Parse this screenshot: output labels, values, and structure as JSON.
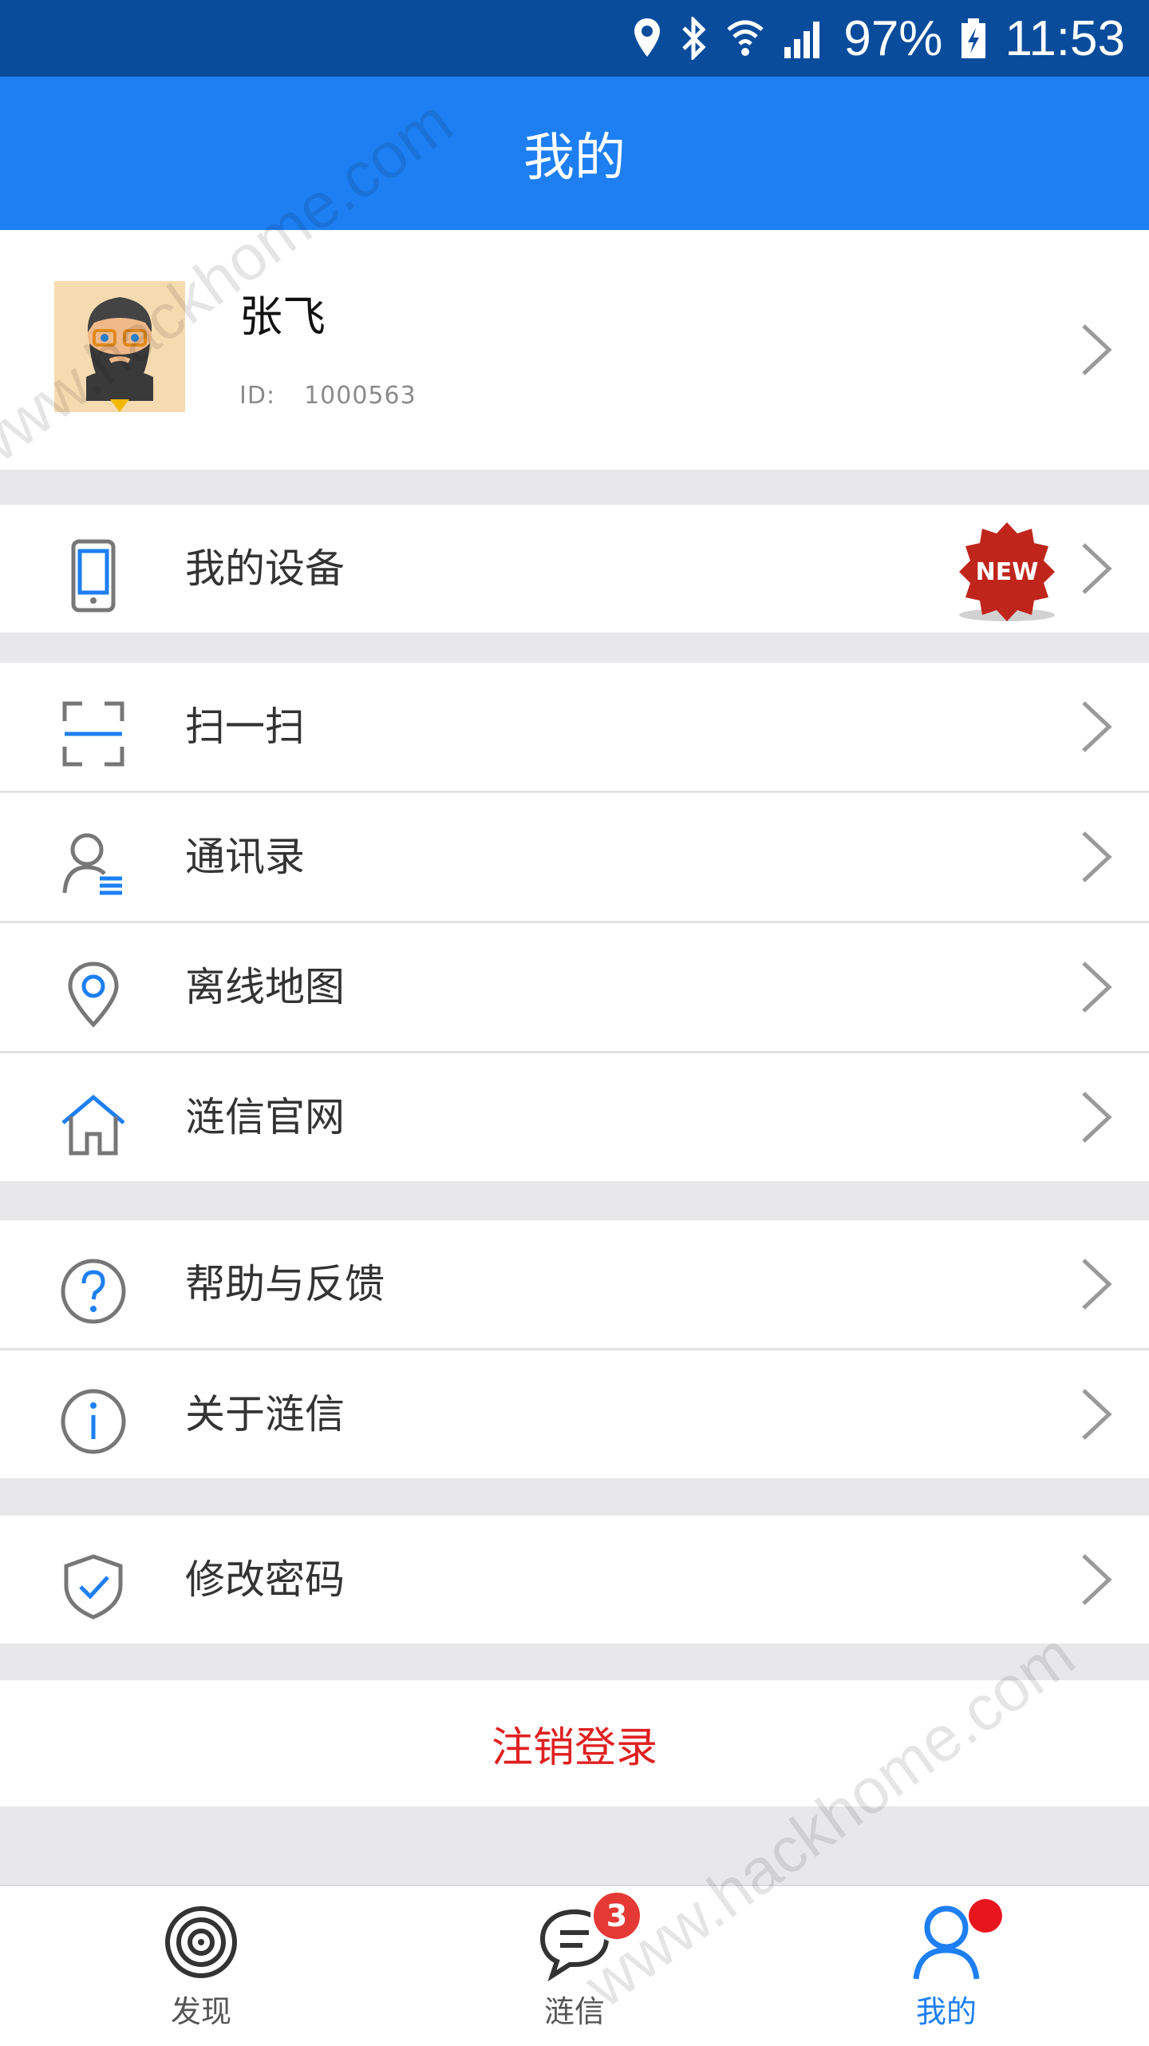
{
  "status_bar": {
    "battery": "97%",
    "time": "11:53"
  },
  "header": {
    "title": "我的"
  },
  "profile": {
    "name": "张飞",
    "id_label": "ID:",
    "id_value": "1000563"
  },
  "menu": [
    {
      "label": "我的设备",
      "icon": "phone-device-icon",
      "badge": "NEW"
    },
    {
      "label": "扫一扫",
      "icon": "scan-icon"
    },
    {
      "label": "通讯录",
      "icon": "contacts-icon"
    },
    {
      "label": "离线地图",
      "icon": "map-pin-icon"
    },
    {
      "label": "涟信官网",
      "icon": "home-icon"
    },
    {
      "label": "帮助与反馈",
      "icon": "help-icon"
    },
    {
      "label": "关于涟信",
      "icon": "info-icon"
    },
    {
      "label": "修改密码",
      "icon": "shield-check-icon"
    }
  ],
  "logout": {
    "label": "注销登录"
  },
  "tabs": [
    {
      "label": "发现",
      "icon": "target-icon"
    },
    {
      "label": "涟信",
      "icon": "chat-icon",
      "badge": "3"
    },
    {
      "label": "我的",
      "icon": "person-icon",
      "active": true
    }
  ],
  "watermark": "www.hackhome.com",
  "colors": {
    "status_bar": "#0a4c9c",
    "header": "#1d7ff2",
    "logout": "#e02020",
    "badge": "#e53935"
  }
}
